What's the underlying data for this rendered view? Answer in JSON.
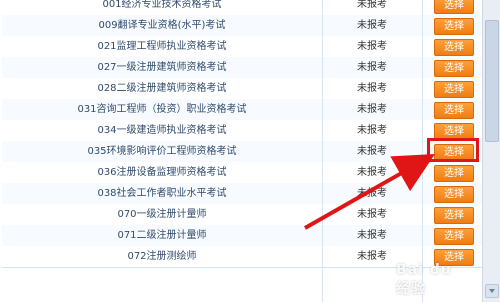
{
  "rows": [
    {
      "name": "001经济专业技术资格考试",
      "status": "未报考",
      "action": "选择"
    },
    {
      "name": "009翻译专业资格(水平)考试",
      "status": "未报考",
      "action": "选择"
    },
    {
      "name": "021监理工程师执业资格考试",
      "status": "未报考",
      "action": "选择"
    },
    {
      "name": "027一级注册建筑师资格考试",
      "status": "未报考",
      "action": "选择"
    },
    {
      "name": "028二级注册建筑师资格考试",
      "status": "未报考",
      "action": "选择"
    },
    {
      "name": "031咨询工程师（投资）职业资格考试",
      "status": "未报考",
      "action": "选择"
    },
    {
      "name": "034一级建造师执业资格考试",
      "status": "未报考",
      "action": "选择"
    },
    {
      "name": "035环境影响评价工程师资格考试",
      "status": "未报考",
      "action": "选择"
    },
    {
      "name": "036注册设备监理师资格考试",
      "status": "未报考",
      "action": "选择"
    },
    {
      "name": "038社会工作者职业水平考试",
      "status": "未报考",
      "action": "选择"
    },
    {
      "name": "070一级注册计量师",
      "status": "未报考",
      "action": "选择"
    },
    {
      "name": "071二级注册计量师",
      "status": "未报考",
      "action": "选择"
    },
    {
      "name": "072注册测绘师",
      "status": "未报考",
      "action": "选择"
    }
  ],
  "watermark": "Bai du 经验",
  "colors": {
    "button": "#f58a1f",
    "highlight": "#e01515",
    "arrow": "#e01515"
  }
}
